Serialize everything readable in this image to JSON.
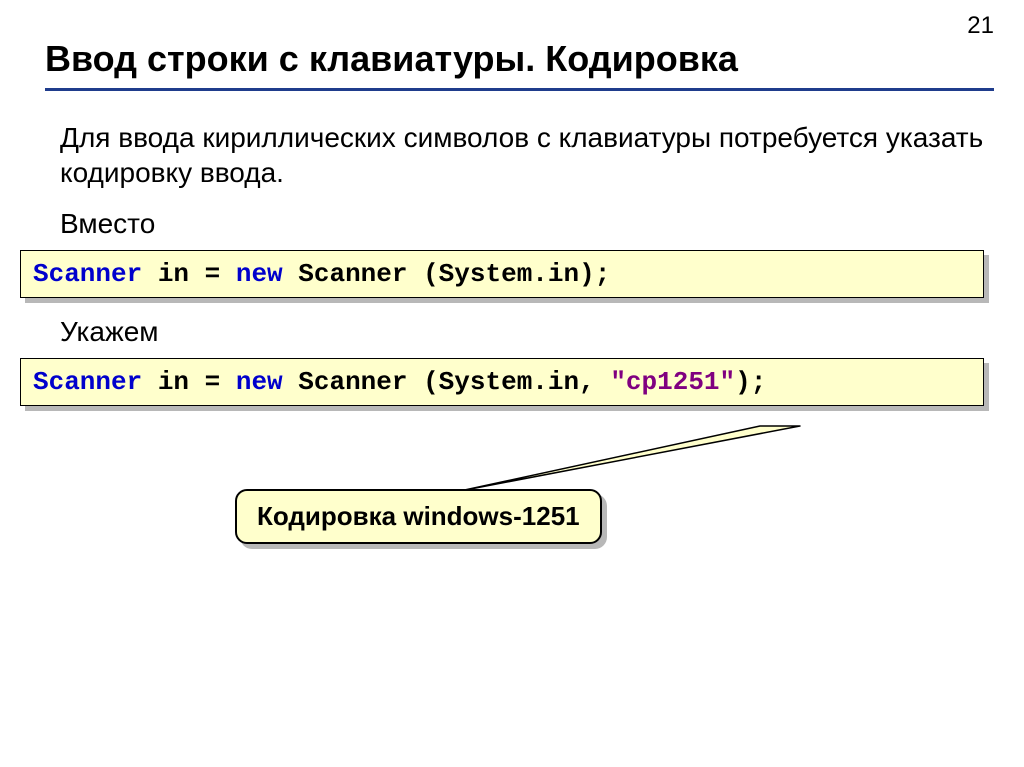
{
  "pageNumber": "21",
  "title": "Ввод строки с клавиатуры. Кодировка",
  "intro": "Для ввода кириллических символов с клавиатуры потребуется указать кодировку ввода.",
  "label1": "Вместо",
  "code1": {
    "t1": "Scanner",
    "t2": " in = ",
    "t3": "new",
    "t4": " Scanner (System.in);"
  },
  "label2": "Укажем",
  "code2": {
    "t1": "Scanner",
    "t2": " in = ",
    "t3": "new",
    "t4": " Scanner (System.in, ",
    "t5": "\"cp1251\"",
    "t6": ");"
  },
  "callout": "Кодировка windows-1251"
}
